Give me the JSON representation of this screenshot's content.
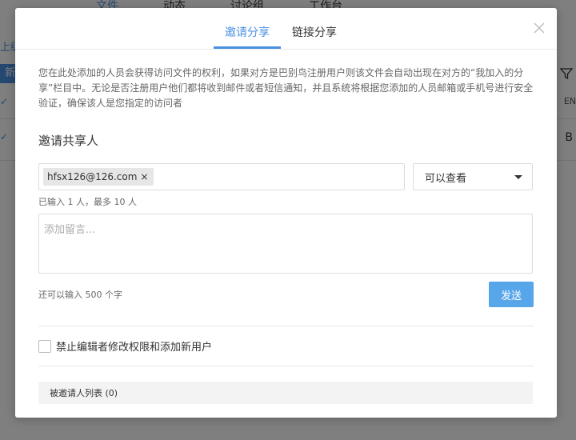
{
  "background": {
    "tabs": [
      "文件",
      "动态",
      "讨论组",
      "工作台"
    ],
    "upper_label": "上级",
    "new_label": "新",
    "right_label_1": "EN",
    "right_label_2": "B"
  },
  "dialog": {
    "tabs": [
      {
        "label": "邀请分享",
        "active": true
      },
      {
        "label": "链接分享",
        "active": false
      }
    ],
    "description": "您在此处添加的人员会获得访问文件的权利，如果对方是巴别鸟注册用户则该文件会自动出现在对方的“我加入的分享”栏目中。无论是否注册用户他们都将收到邮件或者短信通知，并且系统将根据您添加的人员邮箱或手机号进行安全验证，确保该人是您指定的访问者",
    "invite_title": "邀请共享人",
    "invitee_tags": [
      "hfsx126@126.com"
    ],
    "tag_remove": "×",
    "permission_selected": "可以查看",
    "count_hint": "已输入 1 人，最多 10 人",
    "message_placeholder": "添加留言...",
    "remaining_hint": "还可以输入 500 个字",
    "send_label": "发送",
    "restrict_label": "禁止编辑者修改权限和添加新用户",
    "invitee_list_label": "被邀请人列表 (0)"
  },
  "colors": {
    "accent": "#4a90e2",
    "send_button": "#58a6ea"
  }
}
